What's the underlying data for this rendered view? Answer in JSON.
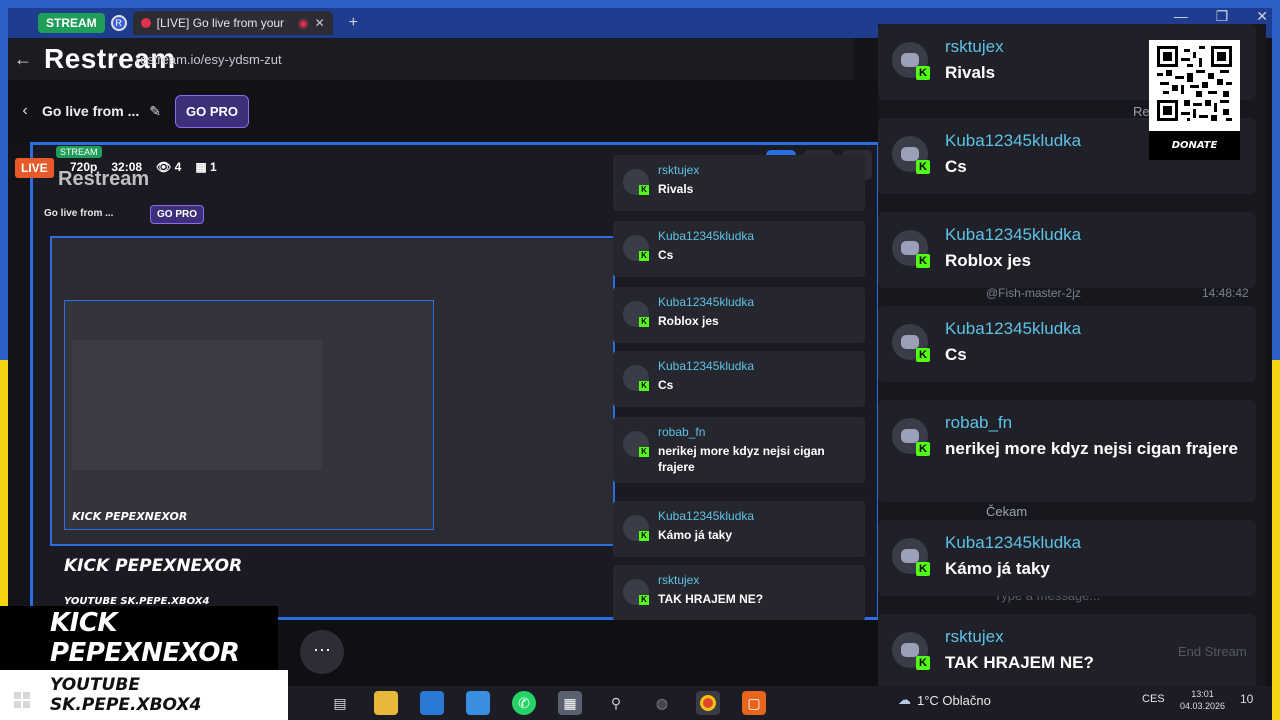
{
  "browser": {
    "tab_group_1": "STREAM",
    "tab_group_2": "R",
    "tab_title": "[LIVE] Go live from your",
    "new_tab": "+",
    "url": "restream.io/esy-ydsm-zut"
  },
  "app": {
    "brand": "Restream",
    "stream_title": "Go live from ...",
    "go_pro": "GO PRO"
  },
  "preview": {
    "live": "LIVE",
    "resolution": "720p",
    "duration": "32:08",
    "viewers": "4",
    "sources": "1",
    "inner_brand": "Restream",
    "inner_title": "Go live from ...",
    "inner_gopro": "GO PRO",
    "inner_tab": "STREAM"
  },
  "mid_chat": [
    {
      "user": "rsktujex",
      "text": "Rivals"
    },
    {
      "user": "Kuba12345kludka",
      "text": "Cs"
    },
    {
      "user": "Kuba12345kludka",
      "text": "Roblox jes"
    },
    {
      "user": "Kuba12345kludka",
      "text": "Cs"
    },
    {
      "user": "robab_fn",
      "text": "nerikej more kdyz nejsi cigan frajere"
    },
    {
      "user": "Kuba12345kludka",
      "text": "Kámo já taky"
    },
    {
      "user": "rsktujex",
      "text": "TAK HRAJEM NE?"
    }
  ],
  "chat": [
    {
      "user": "rsktujex",
      "text": "Rivals"
    },
    {
      "user": "Kuba12345kludka",
      "text": "Cs"
    },
    {
      "user": "Kuba12345kludka",
      "text": "Roblox jes"
    },
    {
      "user": "Kuba12345kludka",
      "text": "Cs"
    },
    {
      "user": "robab_fn",
      "text": "nerikej more kdyz nejsi cigan frajere"
    },
    {
      "user": "Kuba12345kludka",
      "text": "Kámo já taky"
    },
    {
      "user": "rsktujex",
      "text": "TAK HRAJEM NE?"
    }
  ],
  "ghost": {
    "mention": "@Fish-master-2jz",
    "time": "14:48:42",
    "cekam": "Čekam",
    "reply": "Re",
    "end_stream": "End Stream",
    "type_msg": "Type a message..."
  },
  "overlay": {
    "kick": "KICK PEPEXNEXOR",
    "youtube": "YOUTUBE SK.PEPE.XBOX4",
    "donate": "DONATE"
  },
  "taskbar": {
    "weather": "1°C  Oblačno",
    "lang": "CES",
    "time": "13:01",
    "date": "04.03.2026",
    "notifications": "10"
  },
  "colors": {
    "kick_green": "#53fc18",
    "username_blue": "#5ec2e6",
    "accent_blue": "#2a6ee0",
    "live_orange": "#e85a2a"
  }
}
